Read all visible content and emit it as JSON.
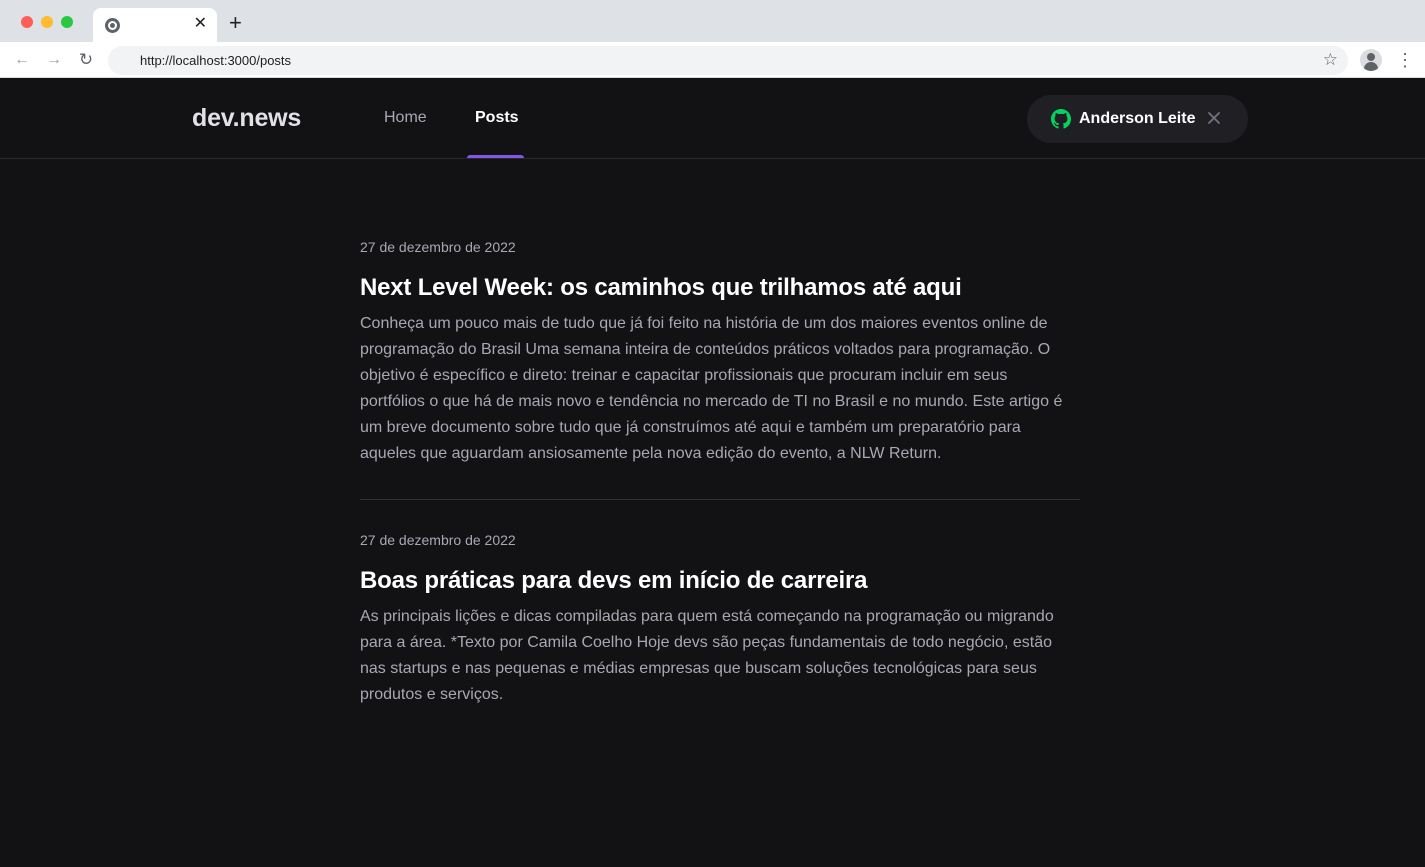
{
  "browser": {
    "url": "http://localhost:3000/posts",
    "tab_close": "✕",
    "new_tab": "+",
    "back": "←",
    "forward": "→",
    "reload": "↻",
    "star": "☆",
    "menu": "⋮"
  },
  "header": {
    "logo": "dev.news",
    "nav": {
      "home": "Home",
      "posts": "Posts"
    },
    "user": {
      "name": "Anderson Leite"
    },
    "colors": {
      "accent": "#8257e5",
      "github_green": "#04d361"
    }
  },
  "posts": [
    {
      "date": "27 de dezembro de 2022",
      "title": "Next Level Week: os caminhos que trilhamos até aqui",
      "excerpt": "Conheça um pouco mais de tudo que já foi feito na história de um dos maiores eventos online de programação do Brasil Uma semana inteira de conteúdos práticos voltados para programação. O objetivo é específico e direto: treinar e capacitar profissionais que procuram incluir em seus portfólios o que há de mais novo e tendência no mercado de TI no Brasil e no mundo. Este artigo é um breve documento sobre tudo que já construímos até aqui e também um preparatório para aqueles que aguardam ansiosamente pela nova edição do evento, a NLW Return."
    },
    {
      "date": "27 de dezembro de 2022",
      "title": "Boas práticas para devs em início de carreira",
      "excerpt": "As principais lições e dicas compiladas para quem está começando na programação ou migrando para a área. *Texto por Camila Coelho Hoje devs são peças fundamentais de todo negócio, estão nas startups e nas pequenas e médias empresas que buscam soluções tecnológicas para seus produtos e serviços."
    }
  ]
}
